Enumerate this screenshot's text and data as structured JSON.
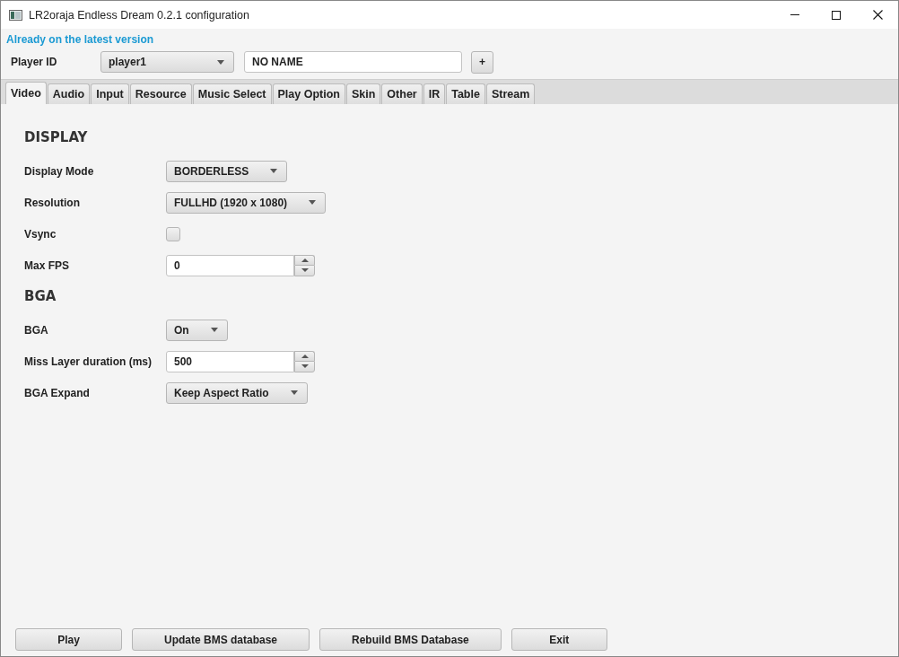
{
  "window": {
    "title": "LR2oraja Endless Dream 0.2.1 configuration"
  },
  "status": "Already on the latest version",
  "player": {
    "label": "Player ID",
    "selected_id": "player1",
    "name": "NO NAME",
    "add_button": "+"
  },
  "tabs": [
    {
      "label": "Video",
      "selected": true
    },
    {
      "label": "Audio",
      "selected": false
    },
    {
      "label": "Input",
      "selected": false
    },
    {
      "label": "Resource",
      "selected": false
    },
    {
      "label": "Music Select",
      "selected": false
    },
    {
      "label": "Play Option",
      "selected": false
    },
    {
      "label": "Skin",
      "selected": false
    },
    {
      "label": "Other",
      "selected": false
    },
    {
      "label": "IR",
      "selected": false
    },
    {
      "label": "Table",
      "selected": false
    },
    {
      "label": "Stream",
      "selected": false
    }
  ],
  "sections": [
    {
      "title": "DISPLAY",
      "rows": [
        {
          "kind": "select",
          "label": "Display Mode",
          "value": "BORDERLESS"
        },
        {
          "kind": "select",
          "label": "Resolution",
          "value": "FULLHD (1920 x 1080)"
        },
        {
          "kind": "checkbox",
          "label": "Vsync",
          "checked": false
        },
        {
          "kind": "spinner",
          "label": "Max FPS",
          "value": "0"
        }
      ]
    },
    {
      "title": "BGA",
      "rows": [
        {
          "kind": "select",
          "label": "BGA",
          "value": "On"
        },
        {
          "kind": "spinner",
          "label": "Miss Layer duration (ms)",
          "value": "500"
        },
        {
          "kind": "select",
          "label": "BGA Expand",
          "value": "Keep Aspect Ratio"
        }
      ]
    }
  ],
  "buttons": [
    "Play",
    "Update BMS database",
    "Rebuild BMS Database",
    "Exit"
  ]
}
